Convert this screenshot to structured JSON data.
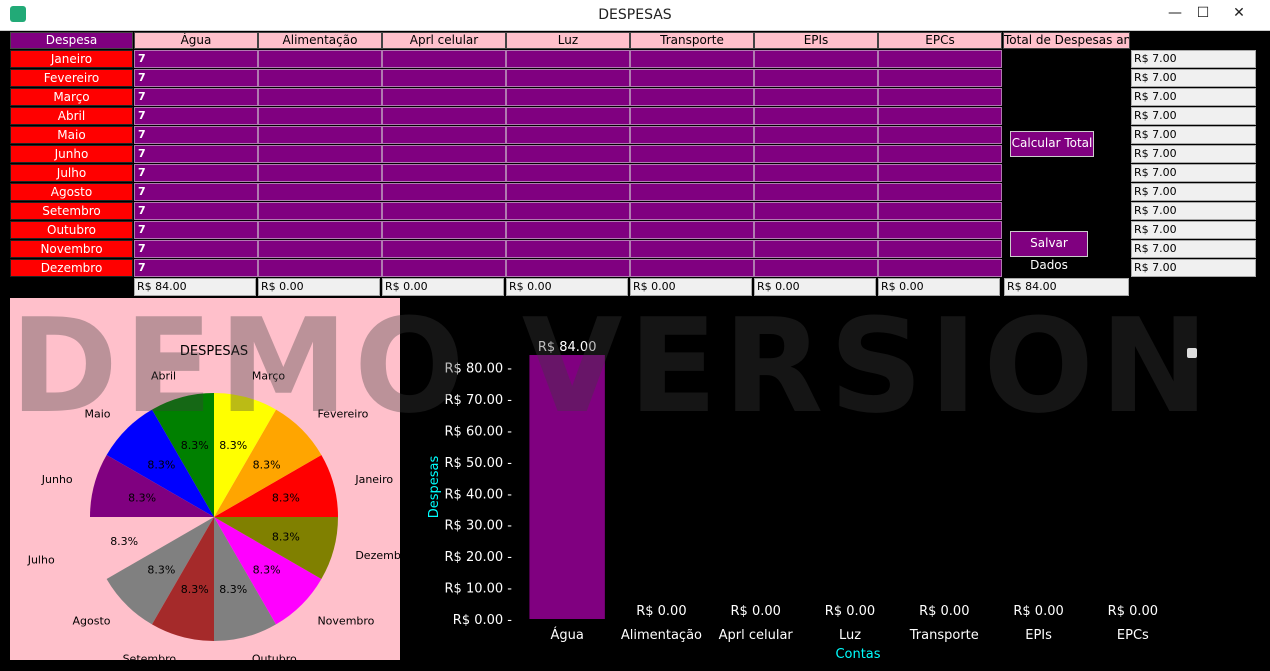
{
  "window": {
    "title": "DESPESAS",
    "minimize": "—",
    "maximize": "☐",
    "close": "✕"
  },
  "table": {
    "corner_header": "Despesa",
    "columns": [
      "Água",
      "Alimentação",
      "Aprl celular",
      "Luz",
      "Transporte",
      "EPIs",
      "EPCs"
    ],
    "annual_header": "Total de Despesas anual",
    "months": [
      "Janeiro",
      "Fevereiro",
      "Março",
      "Abril",
      "Maio",
      "Junho",
      "Julho",
      "Agosto",
      "Setembro",
      "Outubro",
      "Novembro",
      "Dezembro"
    ],
    "first_column_values": [
      "7",
      "7",
      "7",
      "7",
      "7",
      "7",
      "7",
      "7",
      "7",
      "7",
      "7",
      "7"
    ],
    "row_totals": [
      "R$ 7.00",
      "R$ 7.00",
      "R$ 7.00",
      "R$ 7.00",
      "R$ 7.00",
      "R$ 7.00",
      "R$ 7.00",
      "R$ 7.00",
      "R$ 7.00",
      "R$ 7.00",
      "R$ 7.00",
      "R$ 7.00"
    ],
    "column_totals": [
      "R$ 84.00",
      "R$ 0.00",
      "R$ 0.00",
      "R$ 0.00",
      "R$ 0.00",
      "R$ 0.00",
      "R$ 0.00"
    ],
    "grand_total": "R$ 84.00"
  },
  "buttons": {
    "calculate": "Calcular Total",
    "save": "Salvar Dados"
  },
  "watermark": "DEMO VERSION",
  "chart_data": [
    {
      "type": "pie",
      "title": "DESPESAS",
      "labels": [
        "Janeiro",
        "Fevereiro",
        "Março",
        "Abril",
        "Maio",
        "Junho",
        "Julho",
        "Agosto",
        "Setembro",
        "Outubro",
        "Novembro",
        "Dezembro"
      ],
      "values": [
        7,
        7,
        7,
        7,
        7,
        7,
        7,
        7,
        7,
        7,
        7,
        7
      ],
      "pct_labels": [
        "8.3%",
        "8.3%",
        "8.3%",
        "8.3%",
        "8.3%",
        "8.3%",
        "8.3%",
        "8.3%",
        "8.3%",
        "8.3%",
        "8.3%",
        "8.3%"
      ],
      "colors": [
        "#ff0000",
        "#ffa500",
        "#ffff00",
        "#008000",
        "#0000ff",
        "#800080",
        "#ffc0cb",
        "#808080",
        "#a52a2a",
        "#808080",
        "#ff00ff",
        "#808000"
      ],
      "explode_index": 6
    },
    {
      "type": "bar",
      "categories": [
        "Água",
        "Alimentação",
        "Aprl celular",
        "Luz",
        "Transporte",
        "EPIs",
        "EPCs"
      ],
      "values": [
        84,
        0,
        0,
        0,
        0,
        0,
        0
      ],
      "value_labels": [
        "R$ 84.00",
        "R$ 0.00",
        "R$ 0.00",
        "R$ 0.00",
        "R$ 0.00",
        "R$ 0.00",
        "R$ 0.00"
      ],
      "ylabel": "Despesas",
      "xlabel": "Contas",
      "ylim": [
        0,
        84
      ],
      "yticks": [
        0,
        10,
        20,
        30,
        40,
        50,
        60,
        70,
        80
      ],
      "ytick_labels": [
        "R$ 0.00",
        "R$ 10.00",
        "R$ 20.00",
        "R$ 30.00",
        "R$ 40.00",
        "R$ 50.00",
        "R$ 60.00",
        "R$ 70.00",
        "R$ 80.00"
      ],
      "bar_color": "#800080",
      "label_color": "#00ffff"
    }
  ]
}
